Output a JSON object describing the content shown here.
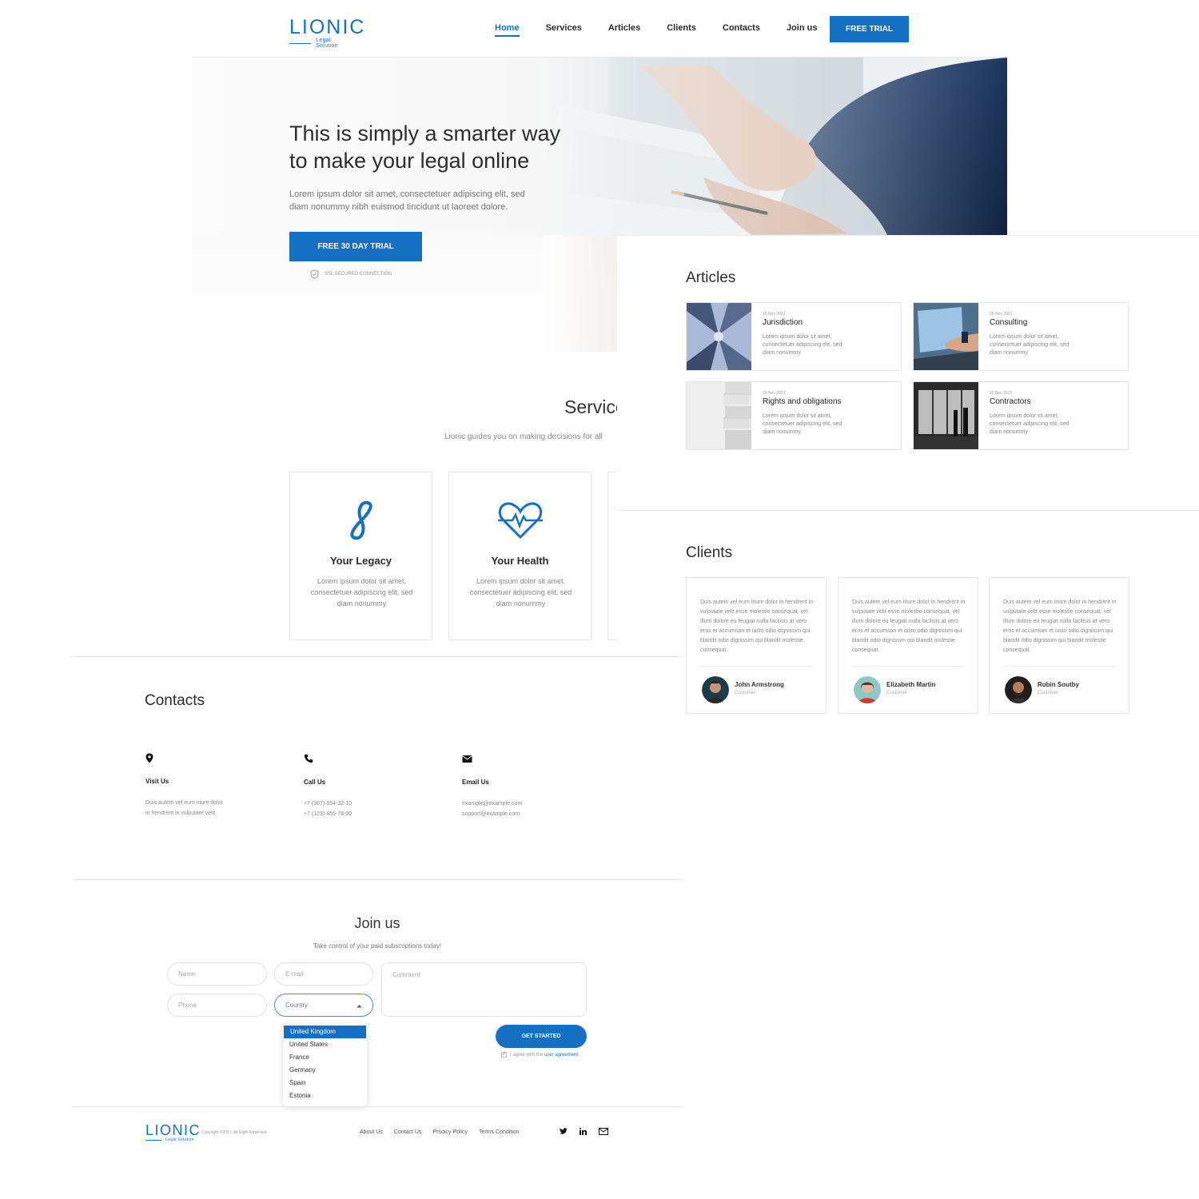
{
  "brand": {
    "name": "LIONIC",
    "tagline": "Legal Solution",
    "accent": "#1570c4"
  },
  "nav": {
    "items": [
      "Home",
      "Services",
      "Articles",
      "Clients",
      "Contacts",
      "Join us"
    ],
    "active": "Home",
    "cta": "FREE TRIAL"
  },
  "hero": {
    "title_line1": "This is simply a smarter way",
    "title_line2": "to make your legal online",
    "description_line1": "Lorem ipsum dolor sit amet, consectetuer adipiscing elit, sed",
    "description_line2": "diam nonummy nibh euismod tincidunt ut laoreet dolore.",
    "cta": "FREE 30 DAY TRIAL",
    "ssl_note": "SSL SECURED CONNECTION"
  },
  "articles": {
    "title": "Articles",
    "items": [
      {
        "date": "15 Nov 2021",
        "title": "Jurisdiction",
        "desc": "Lorem ipsum dolor sit amet, consectetuer adipiscing elit, sed diam nonummy"
      },
      {
        "date": "28 Nov 2021",
        "title": "Consulting",
        "desc": "Lorem ipsum dolor sit amet, consectetuer adipiscing elit, sed diam nonummy"
      },
      {
        "date": "29 Nov 2021",
        "title": "Rights and obligations",
        "desc": "Lorem ipsum dolor sit amet, consectetuer adipiscing elit, sed diam nonummy"
      },
      {
        "date": "11 Dec 2021",
        "title": "Contractors",
        "desc": "Lorem ipsum dolor sit amet, consectetuer adipiscing elit, sed diam nonummy"
      }
    ]
  },
  "services": {
    "title": "Services",
    "subtitle": "Lionic guides you on making decisions for all",
    "items": [
      {
        "icon": "infinity-icon",
        "title": "Your Legacy",
        "desc": "Lorem ipsum dolor sit amet, consectetuer adipiscing elit, sed diam nonummy"
      },
      {
        "icon": "heartbeat-icon",
        "title": "Your Health",
        "desc": "Lorem ipsum dolor sit amet, consectetuer adipiscing elit, sed diam nonummy"
      }
    ]
  },
  "clients": {
    "title": "Clients",
    "items": [
      {
        "quote": "Duis autem vel eum iriure dolor in hendrerit in vulputate velit esse molestie consequat, vel illum dolore eu feugiat nulla facilisis at vero eros et accumsan et iusto odio dignissim qui blandit odio dignissim qui blandit molestie consequat.",
        "name": "John Armstrong",
        "role": "Customer"
      },
      {
        "quote": "Duis autem vel eum iriure dolor in hendrerit in vulputate velit esse molestie consequat, vel illum dolore eu feugiat nulla facilisis at vero eros et accumsan et iusto odio dignissim qui blandit odio dignissim qui blandit molestie consequat.",
        "name": "Elizabeth Martin",
        "role": "Customer"
      },
      {
        "quote": "Duis autem vel eum iriure dolor in hendrerit in vulputate velit esse molestie consequat, vel illum dolore eu feugiat nulla facilisis at vero eros et accumsan et iusto odio dignissim qui blandit odio dignissim qui blandit molestie consequat.",
        "name": "Robin Soutby",
        "role": "Customer"
      }
    ]
  },
  "contacts": {
    "title": "Contacts",
    "visit": {
      "icon": "location-pin-icon",
      "label": "Visit Us",
      "line1": "Duis autem vel eum iriure dolor",
      "line2": "in hendrerit in vulputate velit."
    },
    "call": {
      "icon": "phone-icon",
      "label": "Call Us",
      "line1": "+7 (987) 654-32-10",
      "line2": "+7 (123) 456-78-90"
    },
    "email": {
      "icon": "mail-icon",
      "label": "Email Us",
      "line1": "example@example.com",
      "line2": "support@example.com"
    }
  },
  "join": {
    "title": "Join us",
    "subtitle": "Take control of your paid subscriptions today!",
    "name_placeholder": "Name",
    "email_placeholder": "E-mail",
    "comment_placeholder": "Comment",
    "phone_placeholder": "Phone",
    "country_placeholder": "Country",
    "countries": [
      "United Kingdom",
      "United States",
      "France",
      "Germany",
      "Spain",
      "Estonia"
    ],
    "selected_country": "United Kingdom",
    "submit": "GET STARTED",
    "agree_text": "I agree with the",
    "agree_link": "user agreement"
  },
  "footer": {
    "copyright": "Copyright ©2017. All Right Reserved",
    "links": [
      "About Us",
      "Contact Us",
      "Privacy Policy",
      "Terms Condition"
    ],
    "social": [
      "twitter-icon",
      "linkedin-icon",
      "mail-icon"
    ]
  }
}
